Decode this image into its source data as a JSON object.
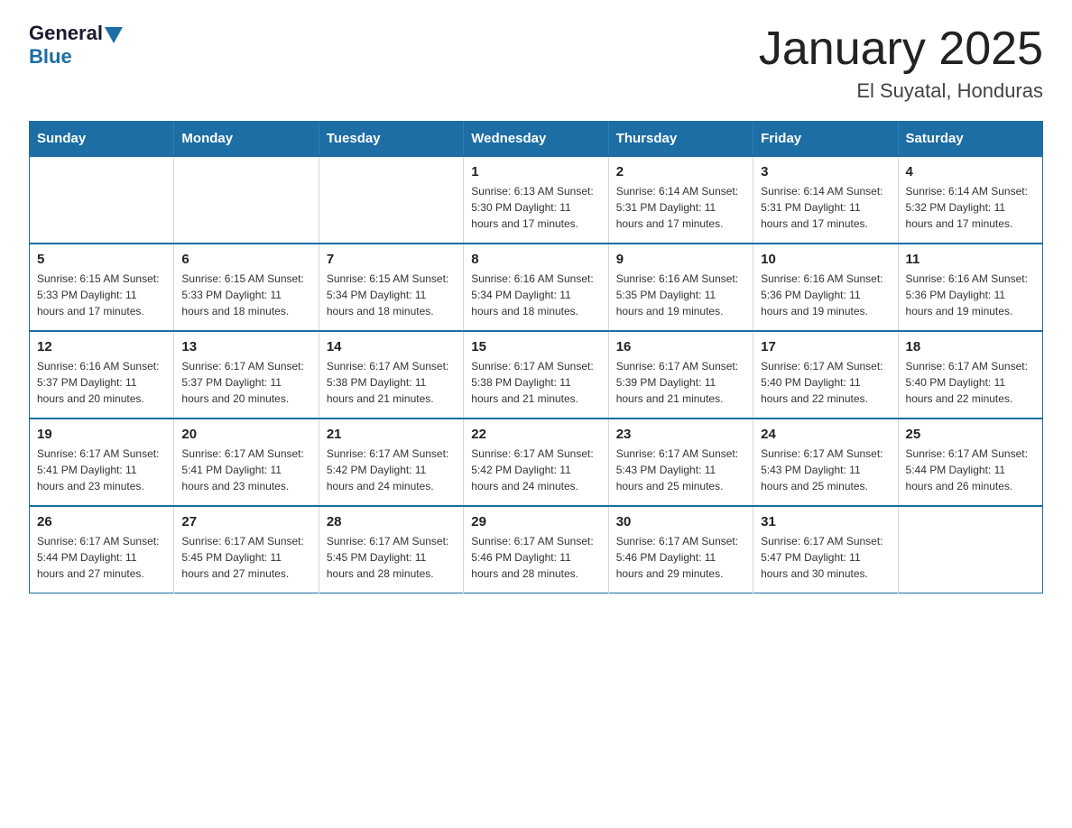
{
  "logo": {
    "general": "General",
    "blue": "Blue"
  },
  "title": "January 2025",
  "subtitle": "El Suyatal, Honduras",
  "days_of_week": [
    "Sunday",
    "Monday",
    "Tuesday",
    "Wednesday",
    "Thursday",
    "Friday",
    "Saturday"
  ],
  "weeks": [
    [
      {
        "day": "",
        "info": ""
      },
      {
        "day": "",
        "info": ""
      },
      {
        "day": "",
        "info": ""
      },
      {
        "day": "1",
        "info": "Sunrise: 6:13 AM\nSunset: 5:30 PM\nDaylight: 11 hours\nand 17 minutes."
      },
      {
        "day": "2",
        "info": "Sunrise: 6:14 AM\nSunset: 5:31 PM\nDaylight: 11 hours\nand 17 minutes."
      },
      {
        "day": "3",
        "info": "Sunrise: 6:14 AM\nSunset: 5:31 PM\nDaylight: 11 hours\nand 17 minutes."
      },
      {
        "day": "4",
        "info": "Sunrise: 6:14 AM\nSunset: 5:32 PM\nDaylight: 11 hours\nand 17 minutes."
      }
    ],
    [
      {
        "day": "5",
        "info": "Sunrise: 6:15 AM\nSunset: 5:33 PM\nDaylight: 11 hours\nand 17 minutes."
      },
      {
        "day": "6",
        "info": "Sunrise: 6:15 AM\nSunset: 5:33 PM\nDaylight: 11 hours\nand 18 minutes."
      },
      {
        "day": "7",
        "info": "Sunrise: 6:15 AM\nSunset: 5:34 PM\nDaylight: 11 hours\nand 18 minutes."
      },
      {
        "day": "8",
        "info": "Sunrise: 6:16 AM\nSunset: 5:34 PM\nDaylight: 11 hours\nand 18 minutes."
      },
      {
        "day": "9",
        "info": "Sunrise: 6:16 AM\nSunset: 5:35 PM\nDaylight: 11 hours\nand 19 minutes."
      },
      {
        "day": "10",
        "info": "Sunrise: 6:16 AM\nSunset: 5:36 PM\nDaylight: 11 hours\nand 19 minutes."
      },
      {
        "day": "11",
        "info": "Sunrise: 6:16 AM\nSunset: 5:36 PM\nDaylight: 11 hours\nand 19 minutes."
      }
    ],
    [
      {
        "day": "12",
        "info": "Sunrise: 6:16 AM\nSunset: 5:37 PM\nDaylight: 11 hours\nand 20 minutes."
      },
      {
        "day": "13",
        "info": "Sunrise: 6:17 AM\nSunset: 5:37 PM\nDaylight: 11 hours\nand 20 minutes."
      },
      {
        "day": "14",
        "info": "Sunrise: 6:17 AM\nSunset: 5:38 PM\nDaylight: 11 hours\nand 21 minutes."
      },
      {
        "day": "15",
        "info": "Sunrise: 6:17 AM\nSunset: 5:38 PM\nDaylight: 11 hours\nand 21 minutes."
      },
      {
        "day": "16",
        "info": "Sunrise: 6:17 AM\nSunset: 5:39 PM\nDaylight: 11 hours\nand 21 minutes."
      },
      {
        "day": "17",
        "info": "Sunrise: 6:17 AM\nSunset: 5:40 PM\nDaylight: 11 hours\nand 22 minutes."
      },
      {
        "day": "18",
        "info": "Sunrise: 6:17 AM\nSunset: 5:40 PM\nDaylight: 11 hours\nand 22 minutes."
      }
    ],
    [
      {
        "day": "19",
        "info": "Sunrise: 6:17 AM\nSunset: 5:41 PM\nDaylight: 11 hours\nand 23 minutes."
      },
      {
        "day": "20",
        "info": "Sunrise: 6:17 AM\nSunset: 5:41 PM\nDaylight: 11 hours\nand 23 minutes."
      },
      {
        "day": "21",
        "info": "Sunrise: 6:17 AM\nSunset: 5:42 PM\nDaylight: 11 hours\nand 24 minutes."
      },
      {
        "day": "22",
        "info": "Sunrise: 6:17 AM\nSunset: 5:42 PM\nDaylight: 11 hours\nand 24 minutes."
      },
      {
        "day": "23",
        "info": "Sunrise: 6:17 AM\nSunset: 5:43 PM\nDaylight: 11 hours\nand 25 minutes."
      },
      {
        "day": "24",
        "info": "Sunrise: 6:17 AM\nSunset: 5:43 PM\nDaylight: 11 hours\nand 25 minutes."
      },
      {
        "day": "25",
        "info": "Sunrise: 6:17 AM\nSunset: 5:44 PM\nDaylight: 11 hours\nand 26 minutes."
      }
    ],
    [
      {
        "day": "26",
        "info": "Sunrise: 6:17 AM\nSunset: 5:44 PM\nDaylight: 11 hours\nand 27 minutes."
      },
      {
        "day": "27",
        "info": "Sunrise: 6:17 AM\nSunset: 5:45 PM\nDaylight: 11 hours\nand 27 minutes."
      },
      {
        "day": "28",
        "info": "Sunrise: 6:17 AM\nSunset: 5:45 PM\nDaylight: 11 hours\nand 28 minutes."
      },
      {
        "day": "29",
        "info": "Sunrise: 6:17 AM\nSunset: 5:46 PM\nDaylight: 11 hours\nand 28 minutes."
      },
      {
        "day": "30",
        "info": "Sunrise: 6:17 AM\nSunset: 5:46 PM\nDaylight: 11 hours\nand 29 minutes."
      },
      {
        "day": "31",
        "info": "Sunrise: 6:17 AM\nSunset: 5:47 PM\nDaylight: 11 hours\nand 30 minutes."
      },
      {
        "day": "",
        "info": ""
      }
    ]
  ]
}
